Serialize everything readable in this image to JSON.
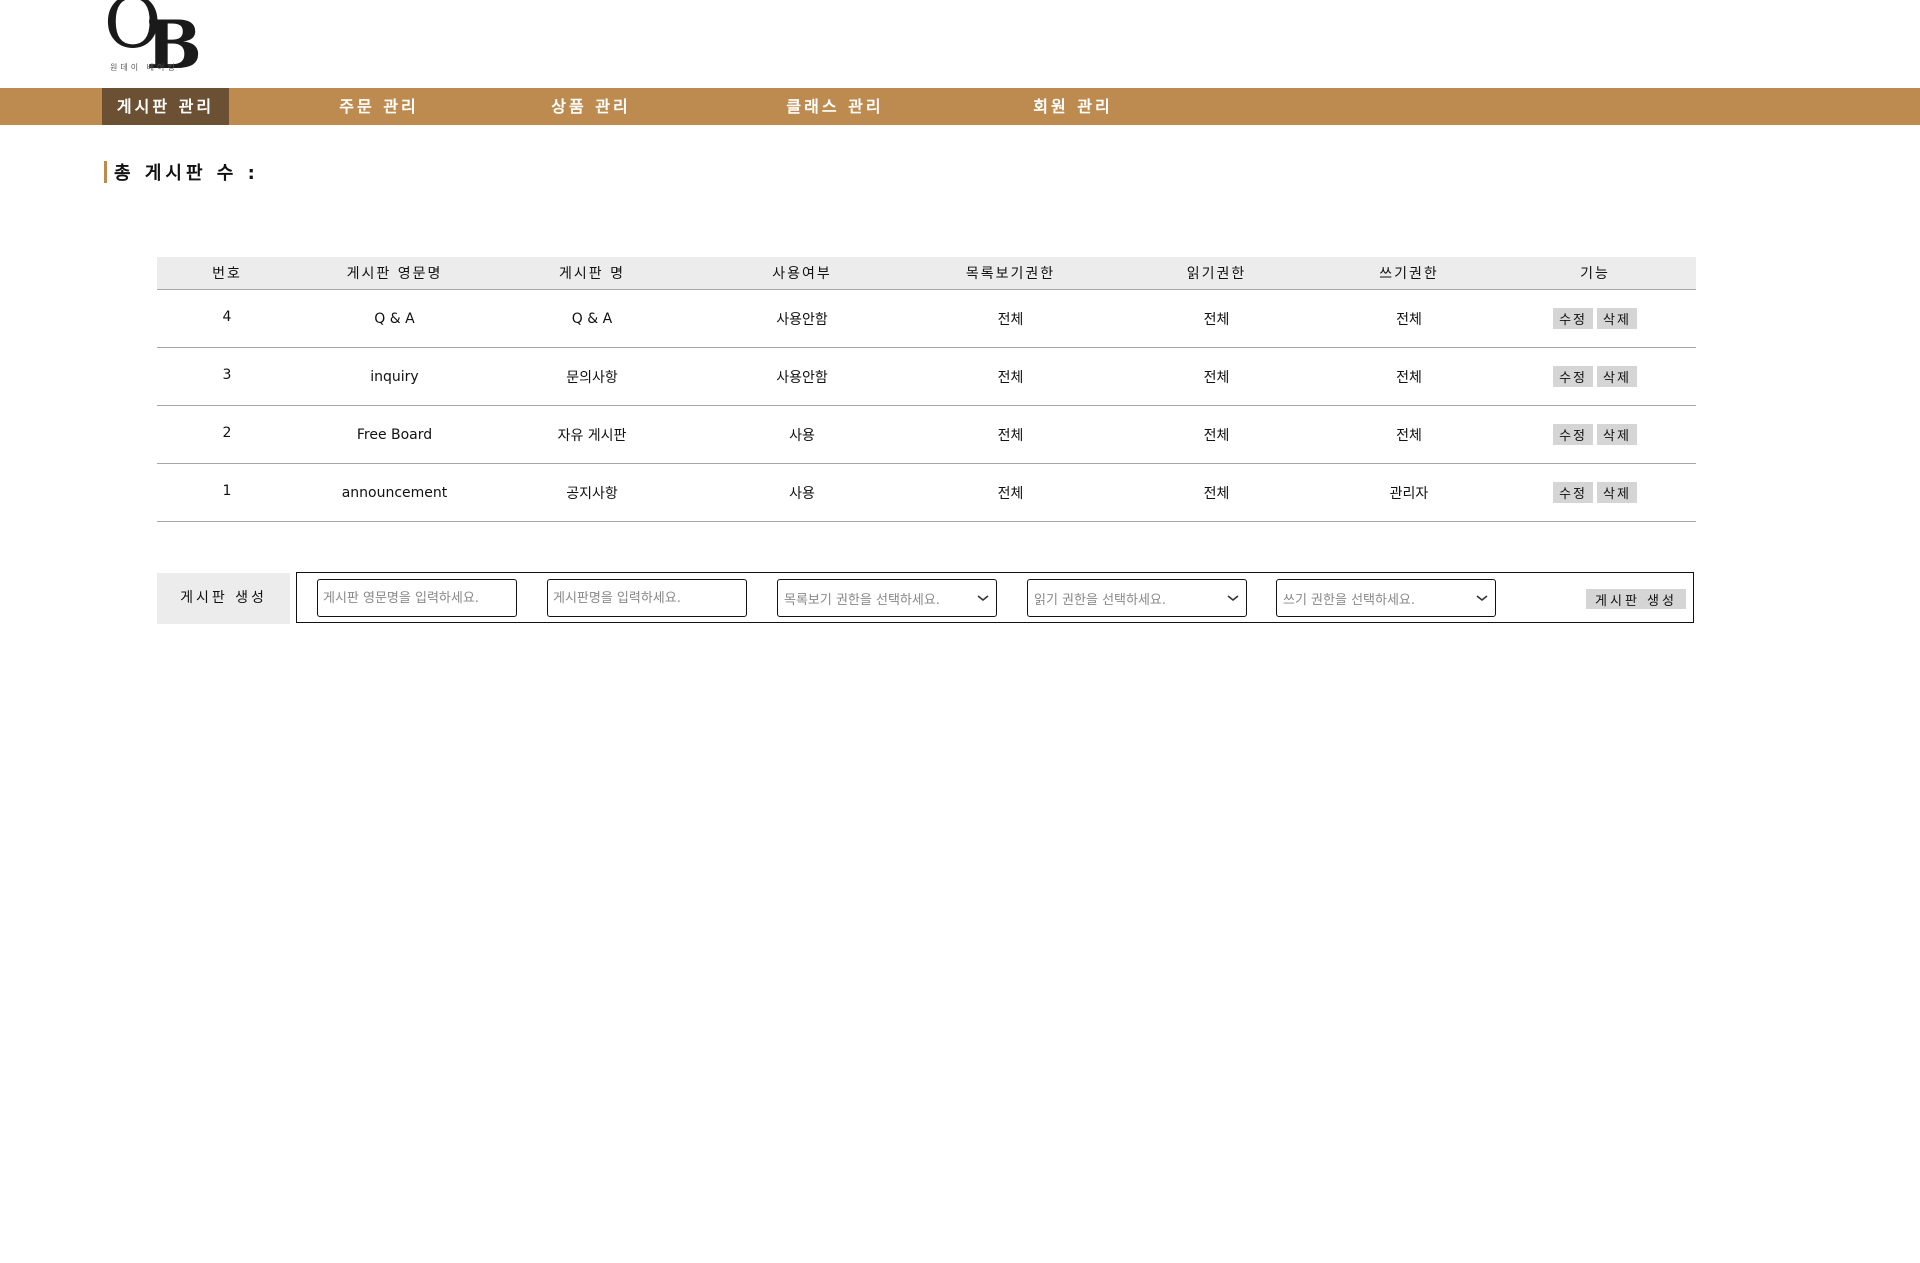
{
  "logo": {
    "letter1": "O",
    "letter2": "B",
    "subtitle": "원데이 베이킹"
  },
  "nav": {
    "items": [
      {
        "label": "게시판 관리",
        "active": true
      },
      {
        "label": "주문 관리",
        "active": false
      },
      {
        "label": "상품 관리",
        "active": false
      },
      {
        "label": "클래스 관리",
        "active": false
      },
      {
        "label": "회원 관리",
        "active": false
      }
    ]
  },
  "colors": {
    "nav_bg": "#bd8b4f",
    "nav_active": "#6b5034",
    "accent": "#bd8b4f"
  },
  "page": {
    "title": "총 게시판 수 :"
  },
  "table": {
    "headers": [
      "번호",
      "게시판 영문명",
      "게시판 명",
      "사용여부",
      "목록보기권한",
      "읽기권한",
      "쓰기권한",
      "기능"
    ],
    "rows": [
      {
        "num": "4",
        "en_name": "Q & A",
        "name": "Q & A",
        "use": "사용안함",
        "list_perm": "전체",
        "read_perm": "전체",
        "write_perm": "전체"
      },
      {
        "num": "3",
        "en_name": "inquiry",
        "name": "문의사항",
        "use": "사용안함",
        "list_perm": "전체",
        "read_perm": "전체",
        "write_perm": "전체"
      },
      {
        "num": "2",
        "en_name": "Free Board",
        "name": "자유 게시판",
        "use": "사용",
        "list_perm": "전체",
        "read_perm": "전체",
        "write_perm": "전체"
      },
      {
        "num": "1",
        "en_name": "announcement",
        "name": "공지사항",
        "use": "사용",
        "list_perm": "전체",
        "read_perm": "전체",
        "write_perm": "관리자"
      }
    ],
    "edit_label": "수정",
    "delete_label": "삭제"
  },
  "create": {
    "label": "게시판 생성",
    "en_name_placeholder": "게시판 영문명을 입력하세요.",
    "name_placeholder": "게시판명을 입력하세요.",
    "list_perm_placeholder": "목록보기 권한을 선택하세요.",
    "read_perm_placeholder": "읽기 권한을 선택하세요.",
    "write_perm_placeholder": "쓰기 권한을 선택하세요.",
    "button_label": "게시판 생성"
  }
}
